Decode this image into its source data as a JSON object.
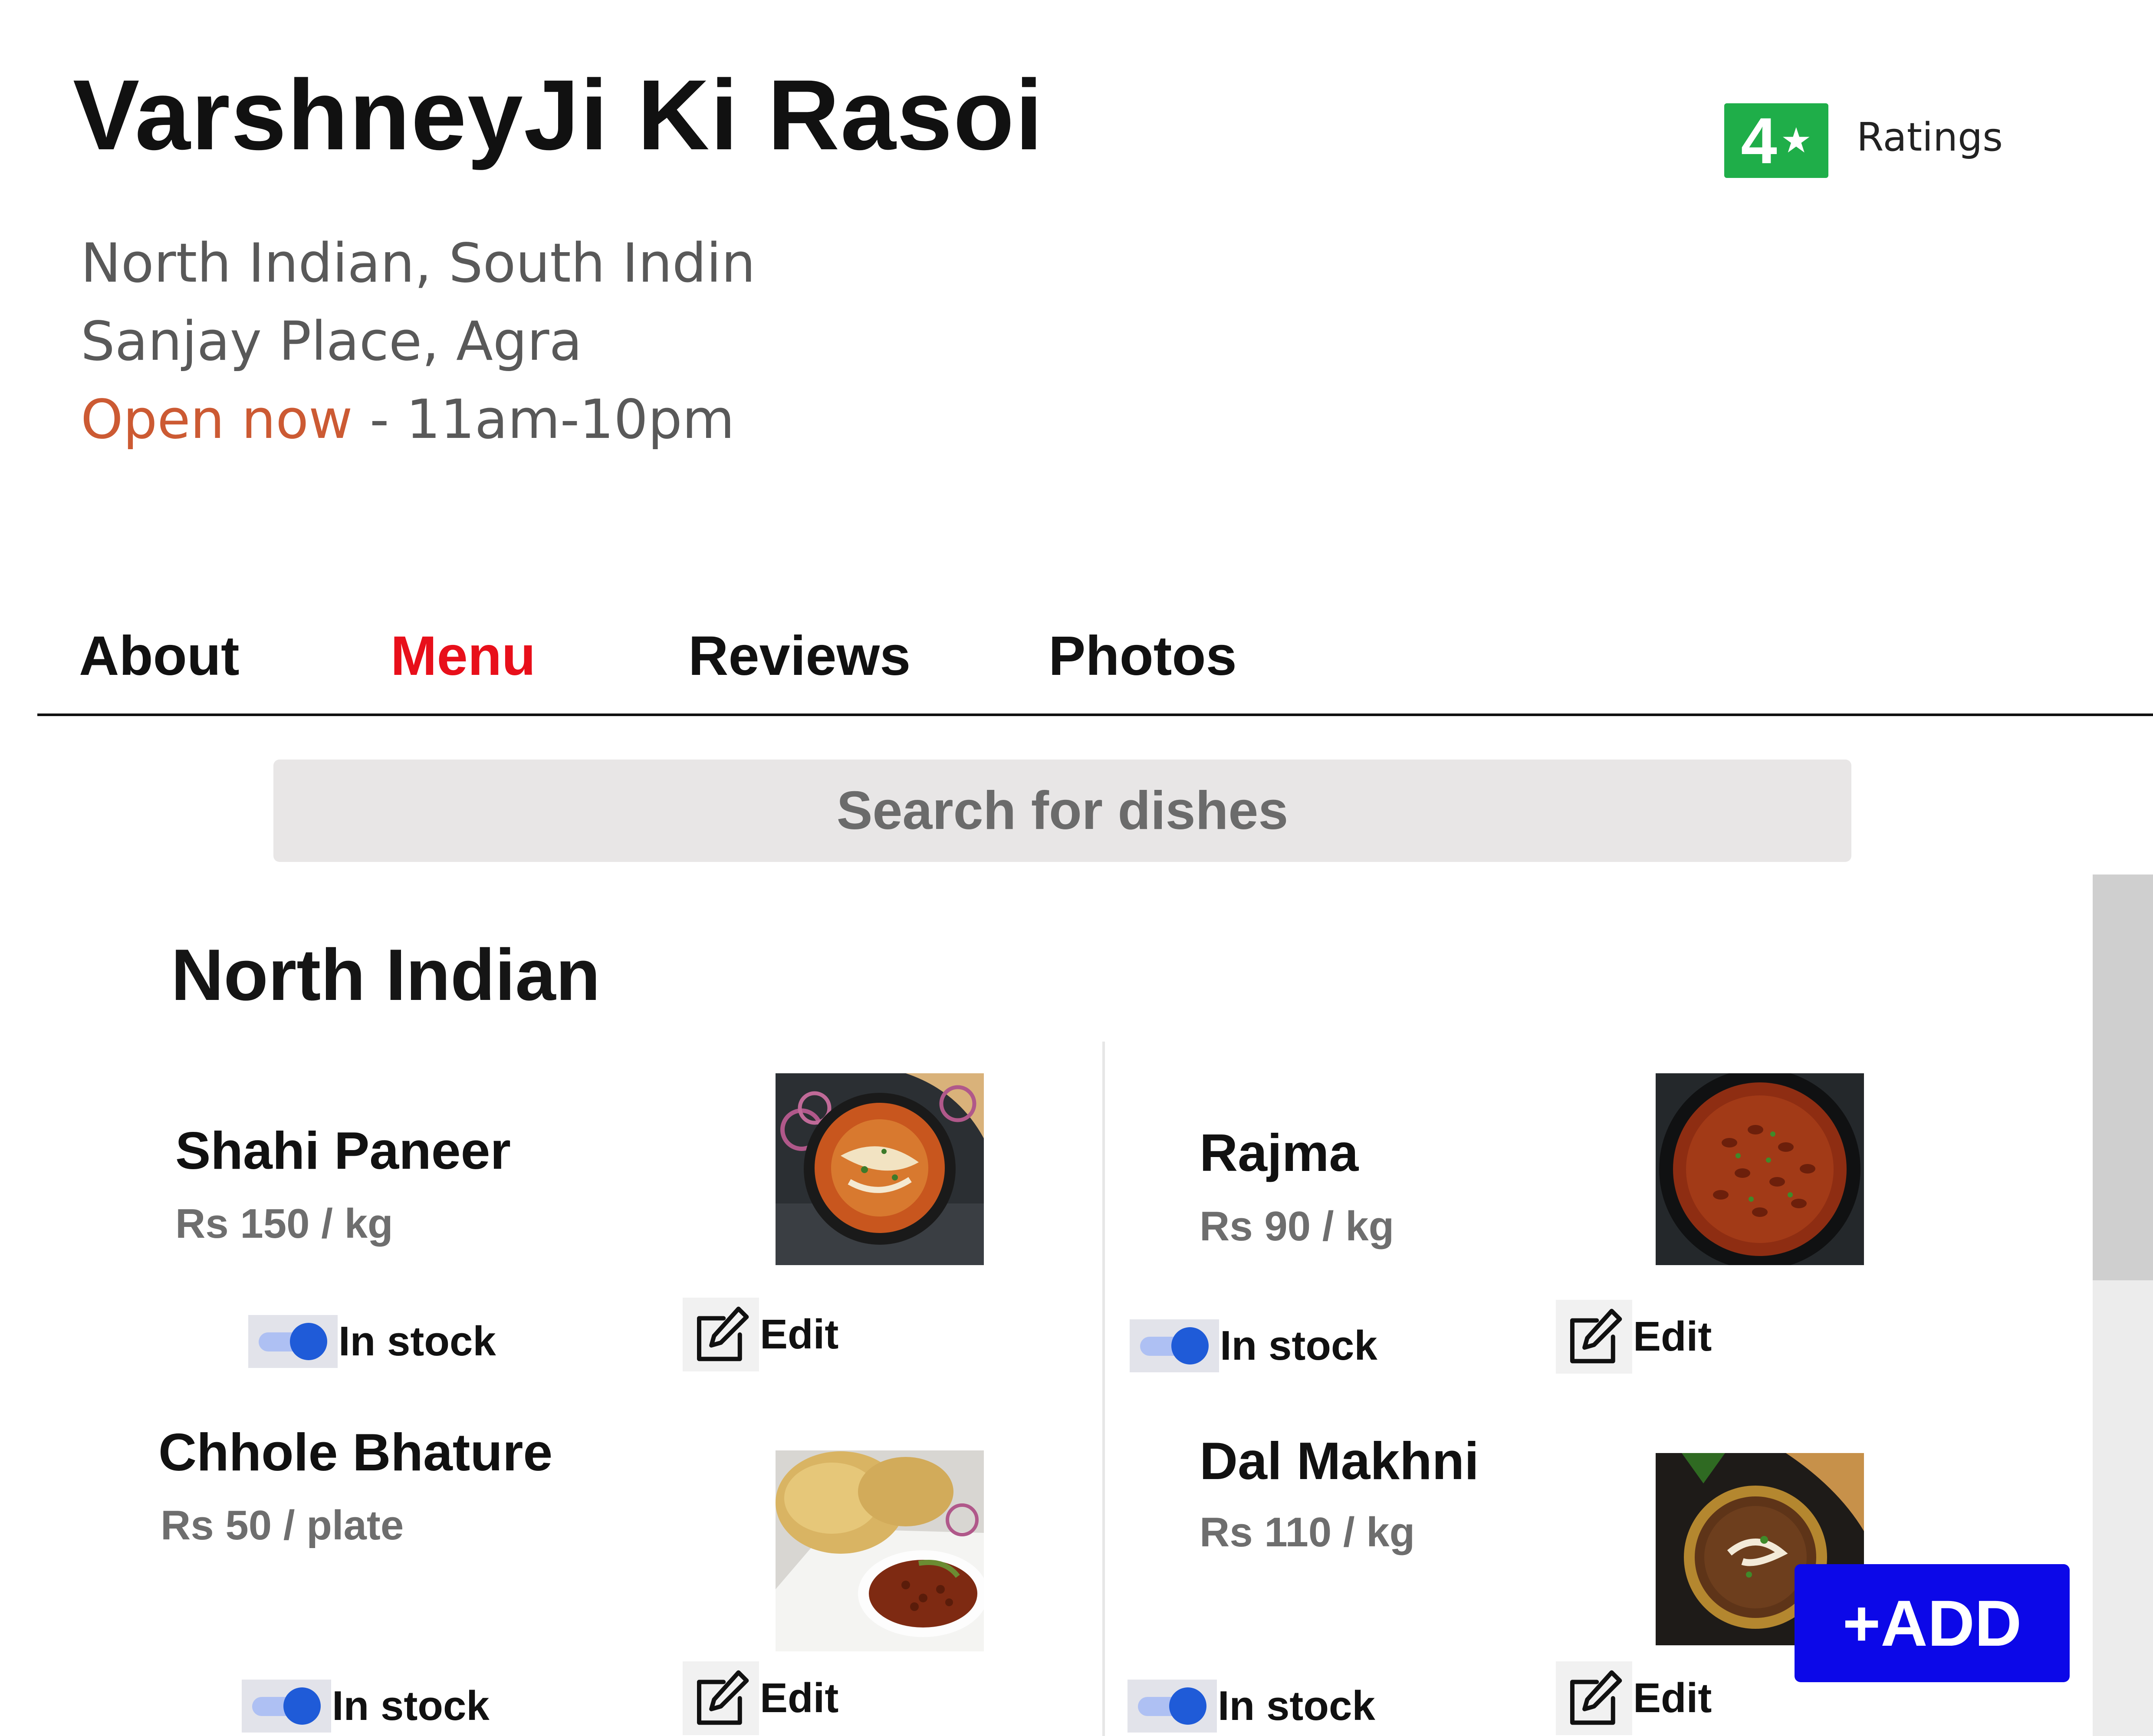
{
  "restaurant": {
    "name": "VarshneyJi Ki Rasoi",
    "cuisines": "North Indian, South Indin",
    "location": "Sanjay Place, Agra",
    "open_status": "Open now",
    "hours": " - 11am-10pm"
  },
  "rating": {
    "value": "4",
    "star": "★",
    "label": "Ratings",
    "badge_color": "#1fae49"
  },
  "tabs": [
    {
      "label": "About",
      "active": false
    },
    {
      "label": "Menu",
      "active": true
    },
    {
      "label": "Reviews",
      "active": false
    },
    {
      "label": "Photos",
      "active": false
    }
  ],
  "search": {
    "placeholder": "Search for dishes"
  },
  "section": {
    "title": "North Indian"
  },
  "dishes": [
    {
      "name": "Shahi Paneer",
      "price": "Rs 150 / kg",
      "stock_label": "In stock",
      "in_stock": true,
      "edit_label": "Edit",
      "image": "shahi-paneer-image"
    },
    {
      "name": "Rajma",
      "price": "Rs 90 / kg",
      "stock_label": "In stock",
      "in_stock": true,
      "edit_label": "Edit",
      "image": "rajma-image"
    },
    {
      "name": "Chhole Bhature",
      "price": "Rs 50 / plate",
      "stock_label": "In stock",
      "in_stock": true,
      "edit_label": "Edit",
      "image": "chhole-bhature-image"
    },
    {
      "name": "Dal Makhni",
      "price": "Rs 110 / kg",
      "stock_label": "In stock",
      "in_stock": true,
      "edit_label": "Edit",
      "image": "dal-makhni-image"
    }
  ],
  "add_button": {
    "label": "+ADD",
    "color": "#0c08e8"
  },
  "colors": {
    "active_tab": "#e80f1a",
    "open_status": "#cc5a33",
    "toggle_knob": "#1f5bd8"
  }
}
